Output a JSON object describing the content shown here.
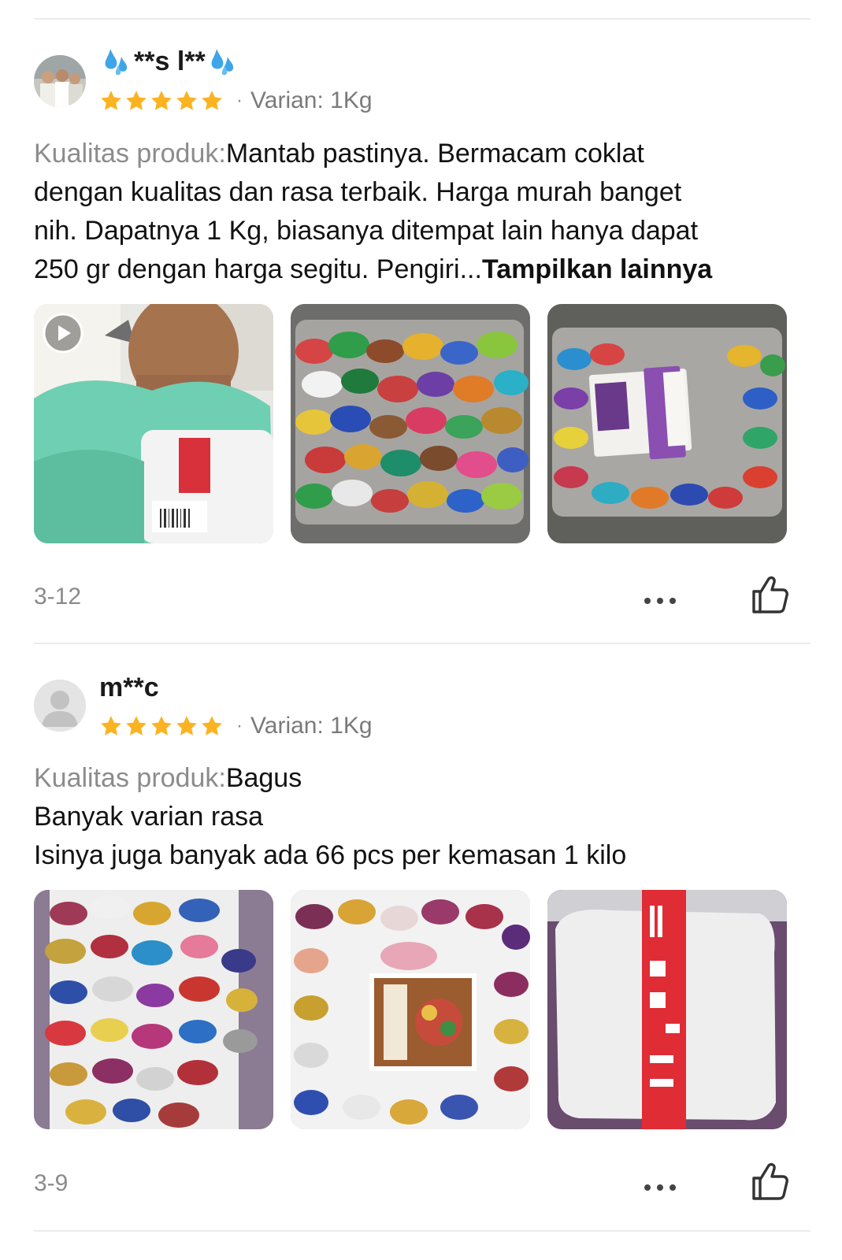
{
  "reviews": [
    {
      "username_core": "**s l**",
      "username_decoration": "sweat-droplets-emoji",
      "rating": 5,
      "rating_max": 5,
      "separator": "·",
      "variant": "Varian: 1Kg",
      "label": "Kualitas produk:",
      "text_lines": [
        "Mantab pastinya. Bermacam coklat",
        "dengan kualitas dan rasa terbaik. Harga murah banget",
        "nih. Dapatnya 1 Kg, biasanya ditempat lain hanya dapat",
        "250 gr dengan harga segitu. Pengiri..."
      ],
      "more_label": "Tampilkan lainnya",
      "date": "3-12",
      "photos": [
        "video-man-holding-package",
        "bag-of-wrapped-chocolates",
        "bag-of-chocolates-with-box"
      ]
    },
    {
      "username_core": "m**c",
      "rating": 5,
      "rating_max": 5,
      "separator": "·",
      "variant": "Varian: 1Kg",
      "label": "Kualitas produk:",
      "text_lines": [
        "Bagus",
        "Banyak varian rasa",
        "Isinya juga banyak ada 66 pcs per kemasan 1 kilo"
      ],
      "date": "3-9",
      "photos": [
        "pile-of-wrapped-chocolates",
        "chocolates-with-box",
        "packed-parcel-fragile-tape"
      ]
    }
  ],
  "colors": {
    "star": "#fbb321",
    "label": "#8c8c8c",
    "divider": "#ececec"
  },
  "icons": {
    "play": "play-icon",
    "more": "more-dots-icon",
    "like": "thumbs-up-icon"
  }
}
